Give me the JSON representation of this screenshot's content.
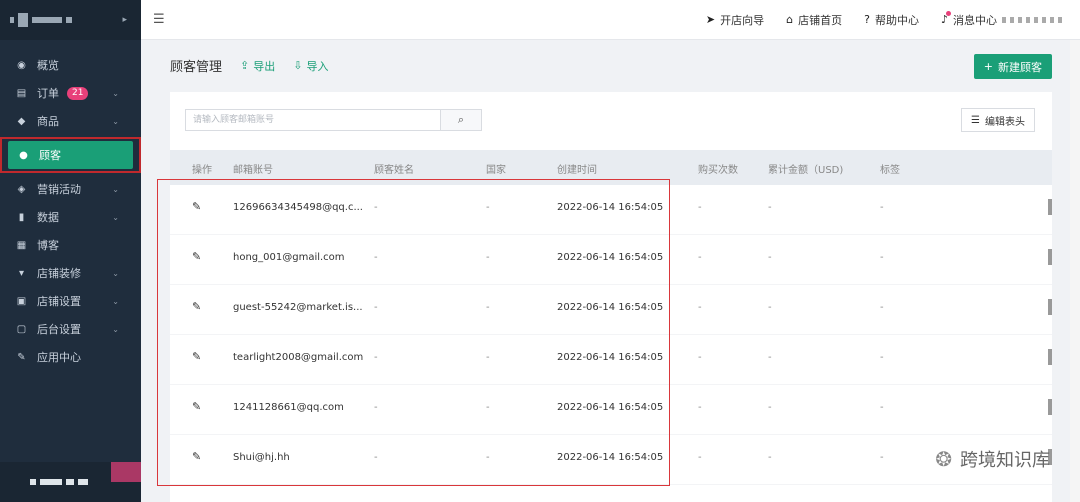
{
  "sidebar": {
    "items": [
      {
        "label": "概览",
        "icon": "dashboard-icon",
        "glyph": "◉",
        "chevron": false,
        "badge": ""
      },
      {
        "label": "订单",
        "icon": "order-icon",
        "glyph": "▤",
        "chevron": true,
        "badge": "21"
      },
      {
        "label": "商品",
        "icon": "product-icon",
        "glyph": "◆",
        "chevron": true,
        "badge": ""
      },
      {
        "label": "顾客",
        "icon": "user-icon",
        "glyph": "●",
        "chevron": false,
        "badge": "",
        "active": true
      },
      {
        "label": "营销活动",
        "icon": "tag-icon",
        "glyph": "◈",
        "chevron": true,
        "badge": ""
      },
      {
        "label": "数据",
        "icon": "chart-icon",
        "glyph": "▮",
        "chevron": true,
        "badge": ""
      },
      {
        "label": "博客",
        "icon": "blog-icon",
        "glyph": "▦",
        "chevron": false,
        "badge": ""
      },
      {
        "label": "店铺装修",
        "icon": "paint-roller-icon",
        "glyph": "▾",
        "chevron": true,
        "badge": ""
      },
      {
        "label": "店铺设置",
        "icon": "store-settings-icon",
        "glyph": "▣",
        "chevron": true,
        "badge": ""
      },
      {
        "label": "后台设置",
        "icon": "monitor-icon",
        "glyph": "▢",
        "chevron": true,
        "badge": ""
      },
      {
        "label": "应用中心",
        "icon": "wrench-icon",
        "glyph": "✎",
        "chevron": false,
        "badge": ""
      }
    ]
  },
  "topbar": {
    "links": [
      {
        "label": "开店向导",
        "icon": "send-icon",
        "glyph": "➤"
      },
      {
        "label": "店铺首页",
        "icon": "home-icon",
        "glyph": "⌂"
      },
      {
        "label": "帮助中心",
        "icon": "help-icon",
        "glyph": "?"
      },
      {
        "label": "消息中心",
        "icon": "bell-icon",
        "glyph": "♪"
      }
    ]
  },
  "page": {
    "title": "顾客管理",
    "export_label": "导出",
    "import_label": "导入",
    "new_button_label": "新建顾客"
  },
  "search": {
    "placeholder": "请输入顾客邮箱账号"
  },
  "edit_columns_label": "编辑表头",
  "table": {
    "headers": [
      "操作",
      "邮箱账号",
      "顾客姓名",
      "国家",
      "创建时间",
      "购买次数",
      "累计金额（USD)",
      "标签"
    ],
    "rows": [
      {
        "email": "12696634345498@qq.c...",
        "name": "-",
        "country": "-",
        "created": "2022-06-14 16:54:05",
        "orders": "-",
        "amount": "-",
        "tags": "-"
      },
      {
        "email": "hong_001@gmail.com",
        "name": "-",
        "country": "-",
        "created": "2022-06-14 16:54:05",
        "orders": "-",
        "amount": "-",
        "tags": "-"
      },
      {
        "email": "guest-55242@market.is...",
        "name": "-",
        "country": "-",
        "created": "2022-06-14 16:54:05",
        "orders": "-",
        "amount": "-",
        "tags": "-"
      },
      {
        "email": "tearlight2008@gmail.com",
        "name": "-",
        "country": "-",
        "created": "2022-06-14 16:54:05",
        "orders": "-",
        "amount": "-",
        "tags": "-"
      },
      {
        "email": "1241128661@qq.com",
        "name": "-",
        "country": "-",
        "created": "2022-06-14 16:54:05",
        "orders": "-",
        "amount": "-",
        "tags": "-"
      },
      {
        "email": "Shui@hj.hh",
        "name": "-",
        "country": "-",
        "created": "2022-06-14 16:54:05",
        "orders": "-",
        "amount": "-",
        "tags": "-"
      }
    ]
  },
  "watermark": {
    "text": "跨境知识库"
  },
  "colors": {
    "accent": "#1a9f77",
    "sidebar": "#1f2d3d",
    "badge": "#e8407a",
    "highlight": "#d9373b"
  }
}
